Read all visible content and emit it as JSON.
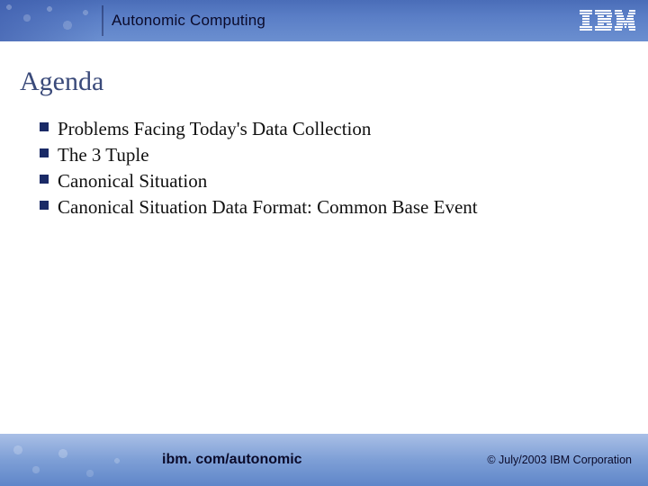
{
  "header": {
    "title": "Autonomic Computing",
    "logo_name": "ibm-logo"
  },
  "slide": {
    "title": "Agenda",
    "bullets": [
      "Problems Facing Today's Data Collection",
      "The 3 Tuple",
      "Canonical Situation",
      "Canonical Situation Data Format: Common Base Event"
    ]
  },
  "footer": {
    "url": "ibm. com/autonomic",
    "copyright": "© July/2003 IBM Corporation"
  }
}
